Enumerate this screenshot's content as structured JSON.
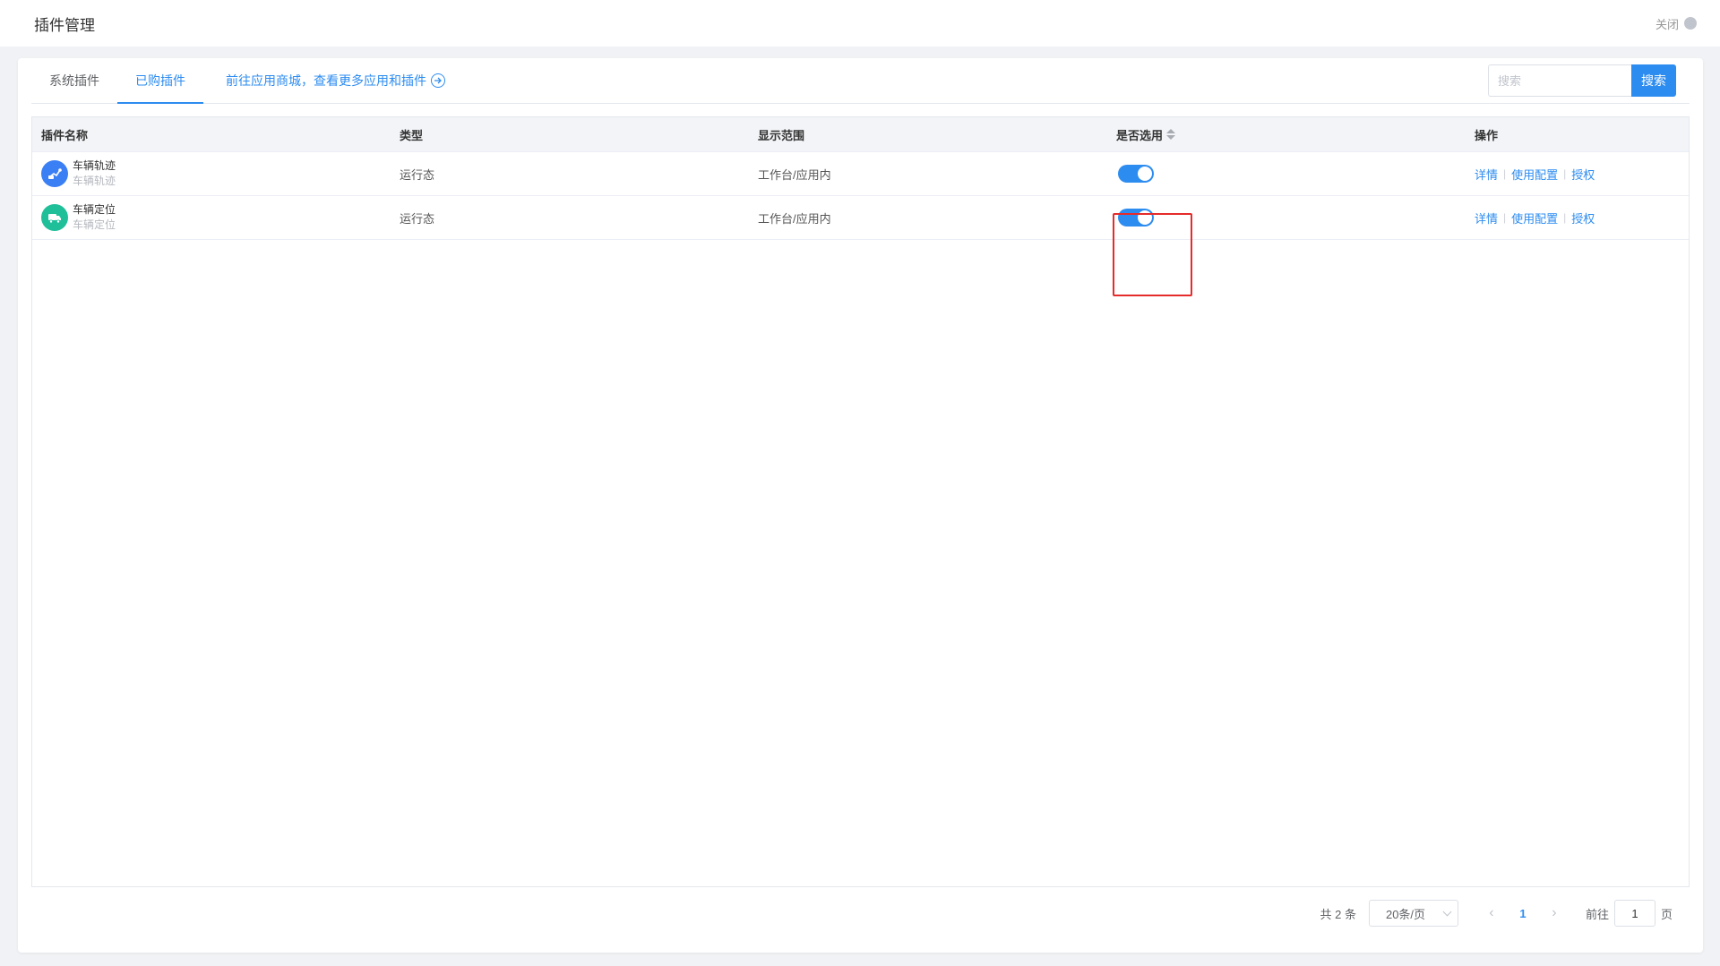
{
  "header": {
    "title": "插件管理",
    "close_label": "关闭"
  },
  "tabs": [
    {
      "label": "系统插件",
      "active": false
    },
    {
      "label": "已购插件",
      "active": true
    },
    {
      "label": "前往应用商城，查看更多应用和插件",
      "active": false
    }
  ],
  "search": {
    "placeholder": "搜索",
    "button_label": "搜索"
  },
  "table": {
    "columns": [
      "插件名称",
      "类型",
      "显示范围",
      "是否选用",
      "操作"
    ],
    "rows": [
      {
        "name": "车辆轨迹",
        "subname": "车辆轨迹",
        "type": "运行态",
        "scope": "工作台/应用内",
        "enabled": true,
        "icon": "route-icon",
        "icon_color": "#3b7ff5",
        "actions": [
          "详情",
          "使用配置",
          "授权"
        ]
      },
      {
        "name": "车辆定位",
        "subname": "车辆定位",
        "type": "运行态",
        "scope": "工作台/应用内",
        "enabled": true,
        "icon": "truck-icon",
        "icon_color": "#1fbf9a",
        "actions": [
          "详情",
          "使用配置",
          "授权"
        ]
      }
    ]
  },
  "pagination": {
    "total_text": "共 2 条",
    "page_size": "20条/页",
    "current_page": "1",
    "goto_label": "前往",
    "goto_value": "1",
    "page_unit": "页"
  },
  "colors": {
    "accent": "#2d8cf0",
    "highlight": "#e52b2b"
  }
}
